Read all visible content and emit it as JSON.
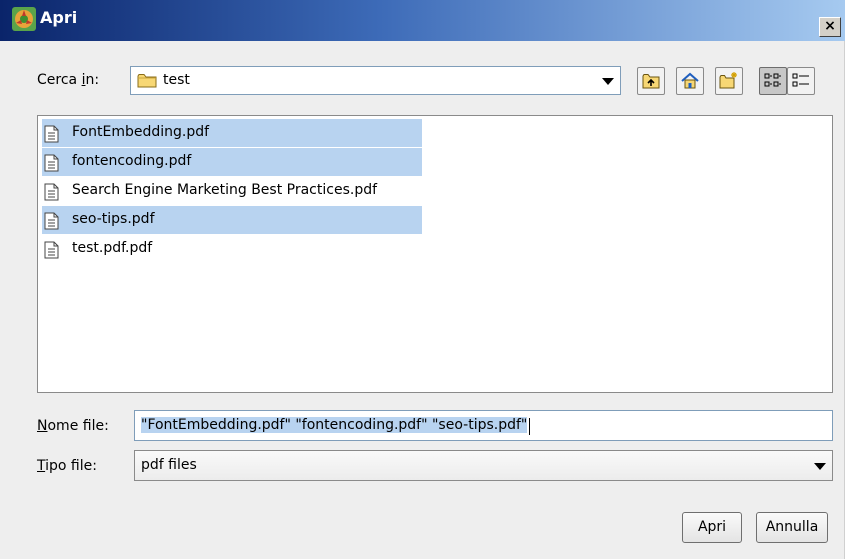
{
  "window": {
    "title": "Apri",
    "close_glyph": "×"
  },
  "lookin": {
    "label_pre": "Cerca ",
    "label_u": "i",
    "label_post": "n:",
    "value": "test"
  },
  "toolbar": {
    "icons": [
      "up-folder-icon",
      "home-icon",
      "new-folder-icon",
      "list-view-icon",
      "details-view-icon"
    ]
  },
  "files": [
    {
      "name": "FontEmbedding.pdf",
      "selected": true
    },
    {
      "name": "fontencoding.pdf",
      "selected": true
    },
    {
      "name": "Search Engine Marketing Best Practices.pdf",
      "selected": false
    },
    {
      "name": "seo-tips.pdf",
      "selected": true
    },
    {
      "name": "test.pdf.pdf",
      "selected": false
    }
  ],
  "filename": {
    "label_u": "N",
    "label_post": "ome file:",
    "value": "\"FontEmbedding.pdf\" \"fontencoding.pdf\" \"seo-tips.pdf\""
  },
  "filetype": {
    "label_u": "T",
    "label_post": "ipo file:",
    "value": "pdf files"
  },
  "buttons": {
    "open": "Apri",
    "cancel": "Annulla"
  },
  "colors": {
    "selection": "#b8d3f0",
    "titlebar_start": "#0a246a",
    "titlebar_end": "#a6caf0"
  }
}
